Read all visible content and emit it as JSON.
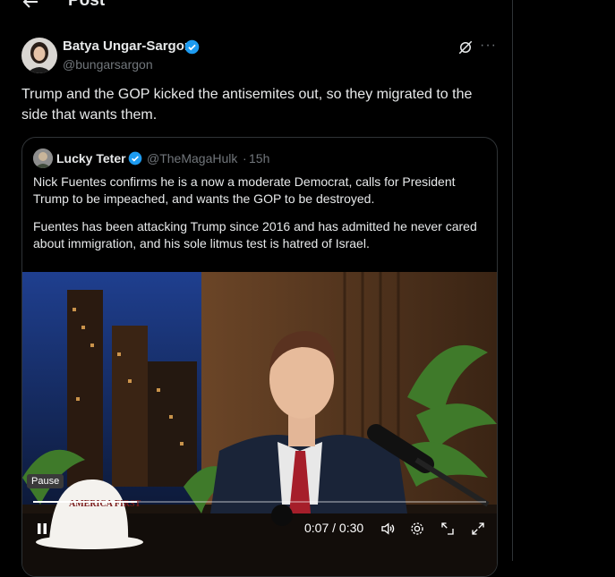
{
  "header": {
    "title": "Post"
  },
  "post": {
    "author_name": "Batya Ungar-Sargon",
    "author_handle": "@bungarsargon",
    "text": "Trump and the GOP kicked the antisemites out, so they migrated to the side that wants them."
  },
  "quote": {
    "author_name": "Lucky Teter",
    "author_handle": "@TheMagaHulk",
    "separator": "·",
    "time": "15h",
    "paragraph1": "Nick Fuentes confirms he is a now a moderate Democrat, calls for President Trump to be impeached, and wants the GOP to be destroyed.",
    "paragraph2": "Fuentes has been attacking Trump since 2016 and has admitted he never cared about immigration, and his sole litmus test is hatred of Israel."
  },
  "video": {
    "tooltip": "Pause",
    "time_display": "0:07 / 0:30",
    "progress": 0.23,
    "hat_text": "AMERICA FIRST"
  },
  "colors": {
    "background": "#000000",
    "text": "#e7e9ea",
    "muted": "#71767b",
    "border": "#2f3336",
    "verified": "#1d9bf0"
  }
}
